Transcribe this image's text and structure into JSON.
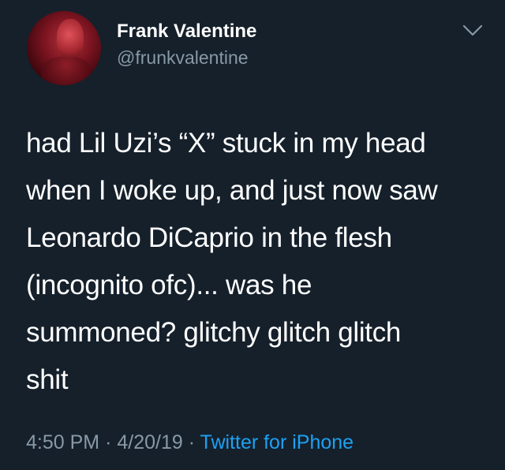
{
  "user": {
    "display_name": "Frank Valentine",
    "handle": "@frunkvalentine",
    "avatar_icon": "profile-photo"
  },
  "menu": {
    "icon": "chevron-down-icon"
  },
  "tweet": {
    "lines": [
      "had Lil Uzi’s “X” stuck in my head",
      "when I woke up, and just now saw",
      "Leonardo DiCaprio in the flesh",
      "(incognito ofc)... was he",
      "summoned? glitchy glitch glitch",
      "shit"
    ]
  },
  "meta": {
    "time": "4:50 PM",
    "separator": "·",
    "date": "4/20/19",
    "source": "Twitter for iPhone"
  },
  "colors": {
    "background": "#15202b",
    "secondary_text": "#8899a6",
    "link": "#1da1f2"
  }
}
